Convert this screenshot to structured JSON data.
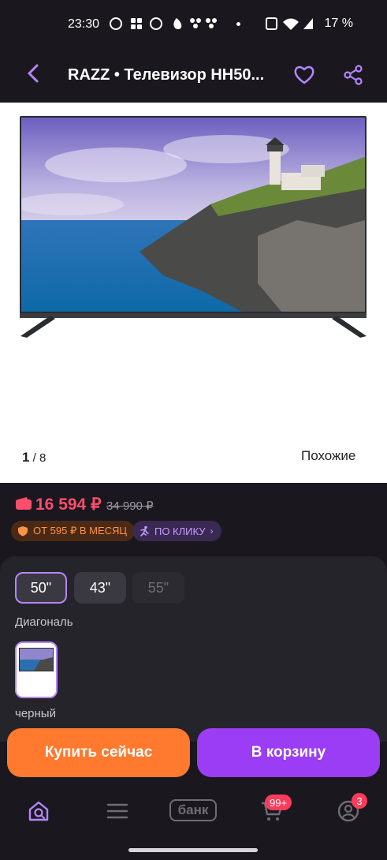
{
  "status_bar": {
    "time": "23:30",
    "battery": "17 %"
  },
  "header": {
    "title": "RAZZ • Телевизор HH50..."
  },
  "gallery": {
    "current": "1",
    "total": "/ 8",
    "similar_label": "Похожие"
  },
  "price": {
    "current": "16 594 ₽",
    "old": "34 990 ₽",
    "installment_label": "ОТ 595 ₽ В МЕСЯЦ",
    "one_click_label": "ПО КЛИКУ"
  },
  "options": {
    "sizes": [
      {
        "label": "50\"",
        "state": "selected"
      },
      {
        "label": "43\"",
        "state": "available"
      },
      {
        "label": "55\"",
        "state": "unavailable"
      }
    ],
    "size_caption": "Диагональ",
    "color_caption": "черный"
  },
  "actions": {
    "buy_now": "Купить сейчас",
    "add_to_cart": "В корзину"
  },
  "nav": {
    "items": [
      "home-icon",
      "menu-icon",
      "bank-icon",
      "cart-icon",
      "profile-icon"
    ],
    "bank_label": "банк",
    "cart_badge": "99+",
    "profile_badge": "3"
  },
  "colors": {
    "accent": "#b586ff",
    "price": "#ff4d6d",
    "buy_button": "#ff7a2e",
    "cart_button": "#9b3df5"
  }
}
